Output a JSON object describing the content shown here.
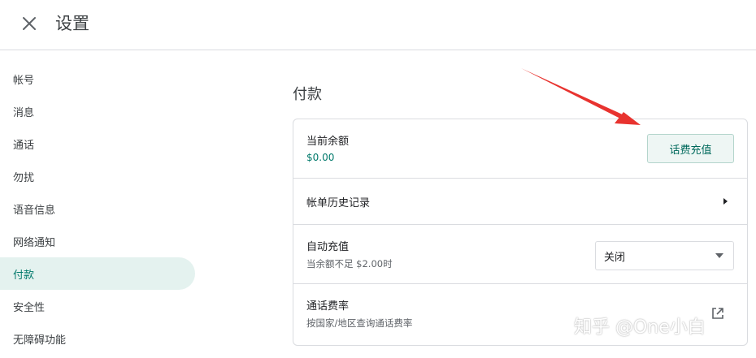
{
  "header": {
    "title": "设置",
    "close_icon": "close-icon"
  },
  "sidebar": {
    "items": [
      {
        "label": "帐号",
        "active": false
      },
      {
        "label": "消息",
        "active": false
      },
      {
        "label": "通话",
        "active": false
      },
      {
        "label": "勿扰",
        "active": false
      },
      {
        "label": "语音信息",
        "active": false
      },
      {
        "label": "网络通知",
        "active": false
      },
      {
        "label": "付款",
        "active": true
      },
      {
        "label": "安全性",
        "active": false
      },
      {
        "label": "无障碍功能",
        "active": false
      }
    ]
  },
  "main": {
    "section_title": "付款",
    "balance": {
      "title": "当前余额",
      "value": "$0.00",
      "button_label": "话费充值"
    },
    "billing_history": {
      "title": "帐单历史记录",
      "icon": "chevron-right-icon"
    },
    "auto_recharge": {
      "title": "自动充值",
      "subtitle": "当余额不足 $2.00时",
      "select_value": "关闭"
    },
    "call_rates": {
      "title": "通话费率",
      "subtitle": "按国家/地区查询通话费率",
      "icon": "open-in-new-icon"
    }
  },
  "annotation": {
    "color": "#e8332f"
  },
  "watermark": {
    "text": "知乎 @One小白"
  },
  "colors": {
    "accent": "#00796b",
    "active_bg": "#e4f2ef",
    "border": "#dadce0"
  }
}
